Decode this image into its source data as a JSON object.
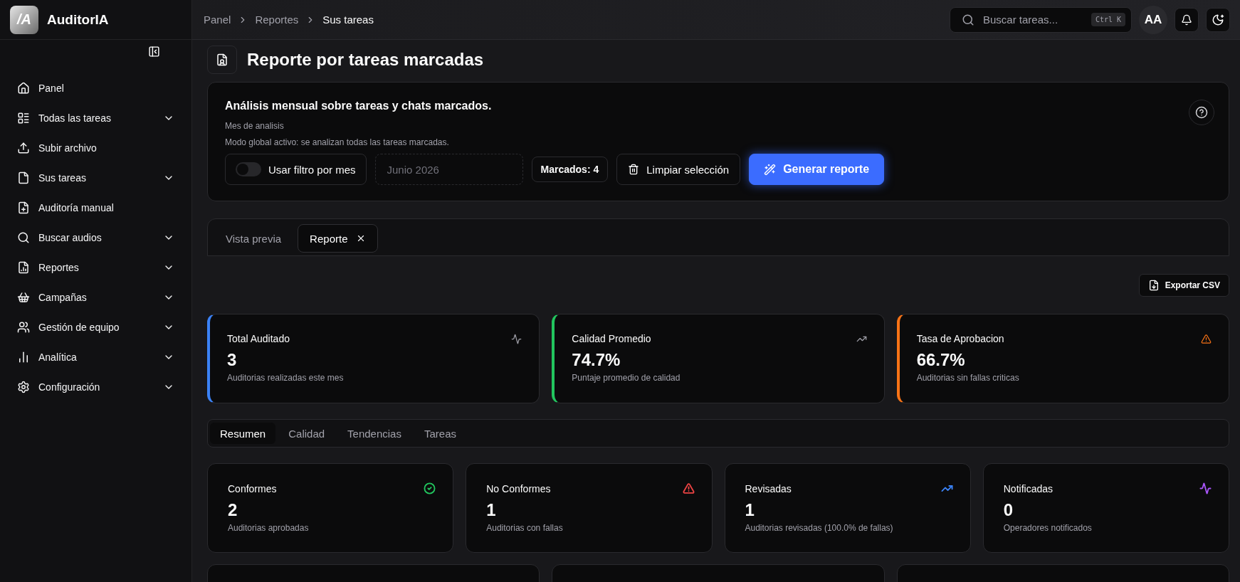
{
  "brand": {
    "name": "AuditorIA",
    "logo": "/A"
  },
  "breadcrumb": [
    {
      "label": "Panel",
      "current": false
    },
    {
      "label": "Reportes",
      "current": false
    },
    {
      "label": "Sus tareas",
      "current": true
    }
  ],
  "search": {
    "placeholder": "Buscar tareas...",
    "shortcut": "Ctrl K"
  },
  "user": {
    "initials": "AA"
  },
  "sidebar": {
    "items": [
      {
        "label": "Panel",
        "expandable": false
      },
      {
        "label": "Todas las tareas",
        "expandable": true
      },
      {
        "label": "Subir archivo",
        "expandable": false
      },
      {
        "label": "Sus tareas",
        "expandable": true
      },
      {
        "label": "Auditoría manual",
        "expandable": false
      },
      {
        "label": "Buscar audios",
        "expandable": true
      },
      {
        "label": "Reportes",
        "expandable": true
      },
      {
        "label": "Campañas",
        "expandable": true
      },
      {
        "label": "Gestión de equipo",
        "expandable": true
      },
      {
        "label": "Analítica",
        "expandable": true
      },
      {
        "label": "Configuración",
        "expandable": true
      }
    ]
  },
  "page_title": "Reporte por tareas marcadas",
  "analysis": {
    "title": "Análisis mensual sobre tareas y chats marcados.",
    "month_label": "Mes de analisis",
    "mode_note": "Modo global activo: se analizan todas las tareas marcadas.",
    "filter_toggle": {
      "label": "Usar filtro por mes",
      "on": false
    },
    "month_field": {
      "placeholder": "Junio 2026"
    },
    "marked": "Marcados: 4",
    "clear_button": "Limpiar selección",
    "generate_button": "Generar reporte"
  },
  "view_tabs": [
    {
      "label": "Vista previa",
      "selected": false,
      "closable": false
    },
    {
      "label": "Reporte",
      "selected": true,
      "closable": true
    }
  ],
  "export_button": "Exportar CSV",
  "stats": [
    {
      "title": "Total Auditado",
      "value": "3",
      "note": "Auditorias realizadas este mes",
      "color": "#3b82f6"
    },
    {
      "title": "Calidad Promedio",
      "value": "74.7%",
      "note": "Puntaje promedio de calidad",
      "color": "#22c55e"
    },
    {
      "title": "Tasa de Aprobacion",
      "value": "66.7%",
      "note": "Auditorias sin fallas criticas",
      "color": "#f97316"
    }
  ],
  "report_tabs": [
    {
      "label": "Resumen",
      "selected": true
    },
    {
      "label": "Calidad",
      "selected": false
    },
    {
      "label": "Tendencias",
      "selected": false
    },
    {
      "label": "Tareas",
      "selected": false
    }
  ],
  "summary": [
    {
      "title": "Conformes",
      "value": "2",
      "note": "Auditorias aprobadas",
      "color": "#22c55e"
    },
    {
      "title": "No Conformes",
      "value": "1",
      "note": "Auditorias con fallas",
      "color": "#ef4444"
    },
    {
      "title": "Revisadas",
      "value": "1",
      "note": "Auditorias revisadas (100.0% de fallas)",
      "color": "#3b82f6"
    },
    {
      "title": "Notificadas",
      "value": "0",
      "note": "Operadores notificados",
      "color": "#a855f7"
    }
  ]
}
